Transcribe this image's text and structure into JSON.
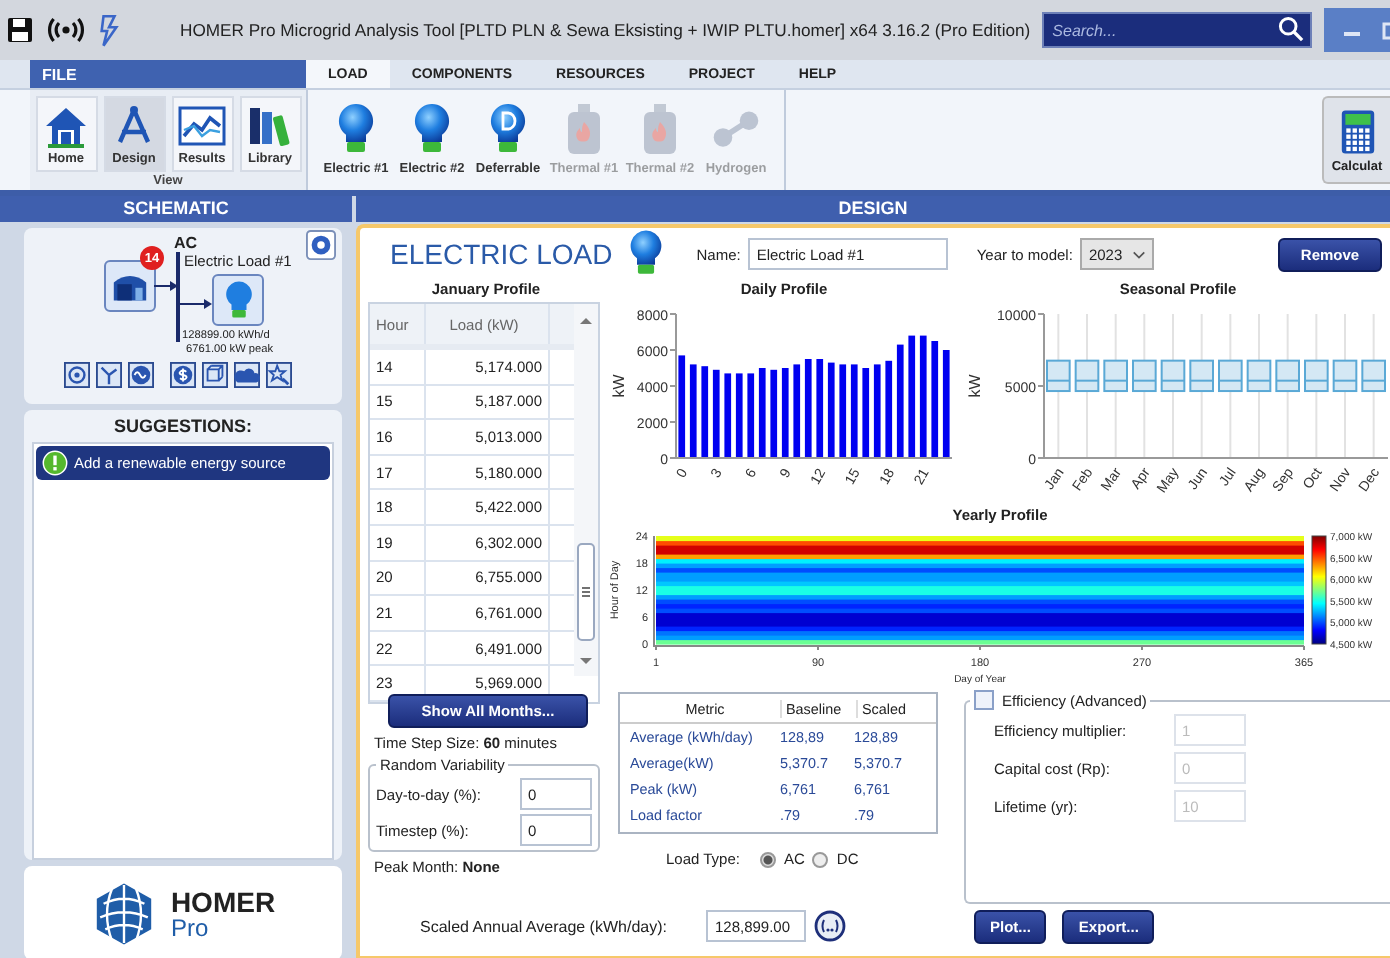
{
  "title_bar": {
    "title": "HOMER Pro Microgrid Analysis Tool [PLTD PLN & Sewa Eksisting + IWIP PLTU.homer]  x64 3.16.2 (Pro Edition)",
    "search": {
      "placeholder": "Search..."
    }
  },
  "ribbon": {
    "file_label": "FILE",
    "tabs": [
      {
        "label": "LOAD",
        "selected": true
      },
      {
        "label": "COMPONENTS",
        "selected": false
      },
      {
        "label": "RESOURCES",
        "selected": false
      },
      {
        "label": "PROJECT",
        "selected": false
      },
      {
        "label": "HELP",
        "selected": false
      }
    ],
    "view_buttons": [
      {
        "label": "Home",
        "kind": "home",
        "selected": false
      },
      {
        "label": "Design",
        "kind": "design",
        "selected": true
      },
      {
        "label": "Results",
        "kind": "results",
        "selected": false
      },
      {
        "label": "Library",
        "kind": "library",
        "selected": false
      }
    ],
    "view_group_label": "View",
    "load_buttons": [
      {
        "label": "Electric #1",
        "kind": "bulb",
        "disabled": false
      },
      {
        "label": "Electric #2",
        "kind": "bulb",
        "disabled": false
      },
      {
        "label": "Deferrable",
        "kind": "deferrable",
        "disabled": false
      },
      {
        "label": "Thermal #1",
        "kind": "thermal",
        "disabled": true
      },
      {
        "label": "Thermal #2",
        "kind": "thermal",
        "disabled": true
      },
      {
        "label": "Hydrogen",
        "kind": "hydrogen",
        "disabled": true
      }
    ],
    "calculate_label": "Calculat"
  },
  "schematic": {
    "header": "SCHEMATIC",
    "bus_label": "AC",
    "generator_badge": "14",
    "load_name": "Electric Load #1",
    "load_energy": "128899.00 kWh/d",
    "load_peak": "6761.00 kW peak"
  },
  "suggestions": {
    "header": "SUGGESTIONS:",
    "items": [
      "Add a renewable energy source"
    ]
  },
  "logo": {
    "name": "HOMER",
    "edition": "Pro"
  },
  "design": {
    "header": "DESIGN",
    "title": "ELECTRIC LOAD",
    "name_label": "Name:",
    "name_value": "Electric Load #1",
    "year_label": "Year to model:",
    "year_value": "2023",
    "remove_label": "Remove",
    "january_profile": {
      "title": "January Profile",
      "columns": [
        "Hour",
        "Load (kW)"
      ],
      "rows": [
        [
          "14",
          "5,174.000"
        ],
        [
          "15",
          "5,187.000"
        ],
        [
          "16",
          "5,013.000"
        ],
        [
          "17",
          "5,180.000"
        ],
        [
          "18",
          "5,422.000"
        ],
        [
          "19",
          "6,302.000"
        ],
        [
          "20",
          "6,755.000"
        ],
        [
          "21",
          "6,761.000"
        ],
        [
          "22",
          "6,491.000"
        ],
        [
          "23",
          "5,969.000"
        ]
      ]
    },
    "show_all_months": "Show All Months...",
    "time_step": "Time Step Size: **60** minutes",
    "random_variability": {
      "title": "Random Variability",
      "fields": [
        {
          "label": "Day-to-day (%):",
          "value": "0"
        },
        {
          "label": "Timestep (%):",
          "value": "0"
        }
      ]
    },
    "peak_month": "Peak Month: **None**",
    "daily_profile": {
      "chart_data": {
        "type": "bar",
        "title": "Daily Profile",
        "ylabel": "kW",
        "x": [
          0,
          1,
          2,
          3,
          4,
          5,
          6,
          7,
          8,
          9,
          10,
          11,
          12,
          13,
          14,
          15,
          16,
          17,
          18,
          19,
          20,
          21,
          22,
          23
        ],
        "values": [
          5700,
          5200,
          5100,
          4900,
          4700,
          4700,
          4700,
          5000,
          4900,
          5000,
          5200,
          5500,
          5500,
          5300,
          5200,
          5200,
          5000,
          5200,
          5400,
          6300,
          6800,
          6800,
          6500,
          6000
        ],
        "xlim": [
          -0.5,
          23.5
        ],
        "ylim": [
          0,
          8000
        ],
        "yticks": [
          0,
          2000,
          4000,
          6000,
          8000
        ],
        "xticks": [
          0,
          3,
          6,
          9,
          12,
          15,
          18,
          21
        ]
      }
    },
    "seasonal_profile": {
      "title": "Seasonal Profile",
      "ylabel": "kW",
      "yticks": [
        "10000",
        "5000",
        "0"
      ],
      "months": [
        "Jan",
        "Feb",
        "Mar",
        "Apr",
        "May",
        "Jun",
        "Jul",
        "Aug",
        "Sep",
        "Oct",
        "Nov",
        "Dec"
      ]
    },
    "yearly_profile": {
      "title": "Yearly Profile",
      "ylabel": "Hour of Day",
      "xlabel": "Day of Year",
      "yticks": [
        "24",
        "18",
        "12",
        "6",
        "0"
      ],
      "xticks": [
        "1",
        "90",
        "180",
        "270",
        "365"
      ],
      "legend": [
        "7,000 kW",
        "6,500 kW",
        "6,000 kW",
        "5,500 kW",
        "5,000 kW",
        "4,500 kW"
      ]
    },
    "metrics": {
      "columns": [
        "Metric",
        "Baseline",
        "Scaled"
      ],
      "rows": [
        [
          "Average (kWh/day)",
          "128,89",
          "128,89"
        ],
        [
          "Average(kW)",
          "5,370.7",
          "5,370.7"
        ],
        [
          "Peak (kW)",
          "6,761",
          "6,761"
        ],
        [
          "Load factor",
          ".79",
          ".79"
        ]
      ]
    },
    "load_type": {
      "label": "Load Type:",
      "options": [
        {
          "label": "AC",
          "selected": true
        },
        {
          "label": "DC",
          "selected": false
        }
      ]
    },
    "efficiency": {
      "label": "Efficiency (Advanced)",
      "checked": false,
      "fields": [
        {
          "label": "Efficiency multiplier:",
          "value": "1",
          "disabled": true
        },
        {
          "label": "Capital cost (Rp):",
          "value": "0",
          "disabled": true
        },
        {
          "label": "Lifetime (yr):",
          "value": "10",
          "disabled": true
        }
      ]
    },
    "scaled_average": {
      "label": "Scaled Annual Average (kWh/day):",
      "value": "128,899.00"
    },
    "buttons": [
      "Plot...",
      "Export..."
    ]
  }
}
